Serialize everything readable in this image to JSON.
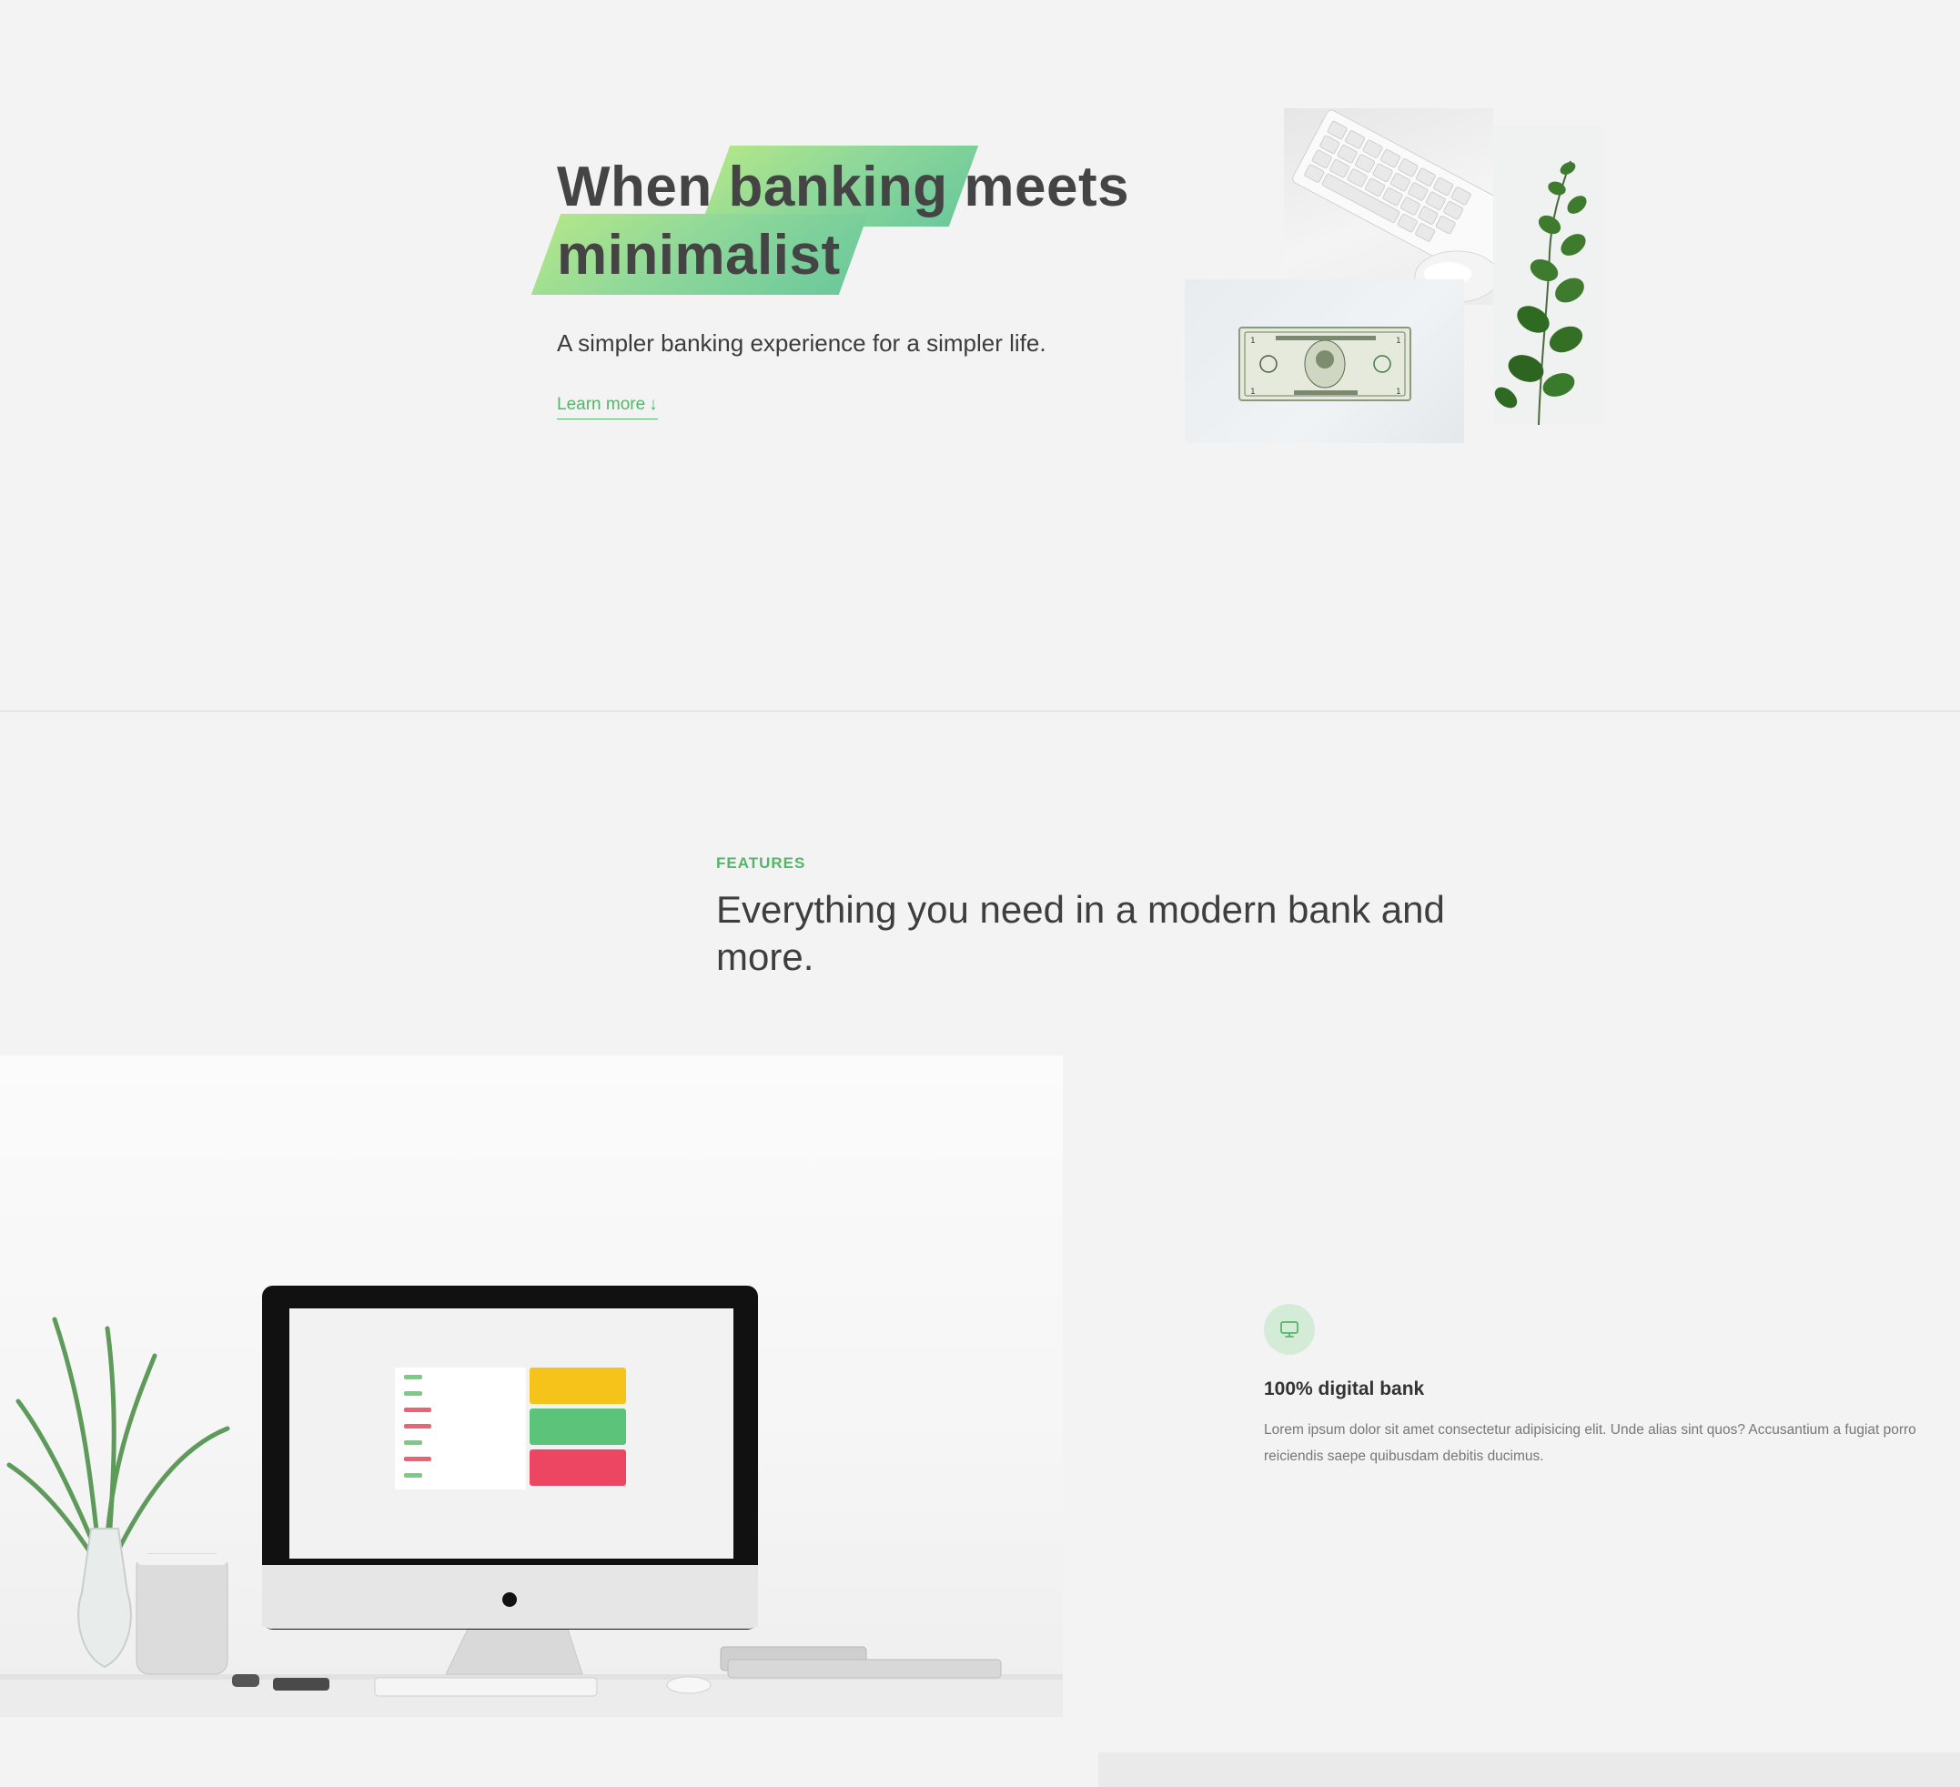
{
  "hero": {
    "title_part1": "When",
    "title_highlight1": "banking",
    "title_part2": "meets",
    "title_highlight2": "minimalist",
    "subtitle": "A simpler banking experience for a simpler life.",
    "learn_more": "Learn more",
    "learn_more_arrow": "↓"
  },
  "features": {
    "eyebrow": "FEATURES",
    "title": "Everything you need in a modern bank and more.",
    "items": [
      {
        "icon": "monitor-icon",
        "title": "100% digital bank",
        "text": "Lorem ipsum dolor sit amet consectetur adipisicing elit. Unde alias sint quos? Accusantium a fugiat porro reiciendis saepe quibusdam debitis ducimus."
      }
    ]
  },
  "colors": {
    "accent": "#55b56a",
    "highlight_start": "#b1e68a",
    "highlight_end": "#6cc99b",
    "background": "#f3f3f3",
    "text": "#444444"
  }
}
